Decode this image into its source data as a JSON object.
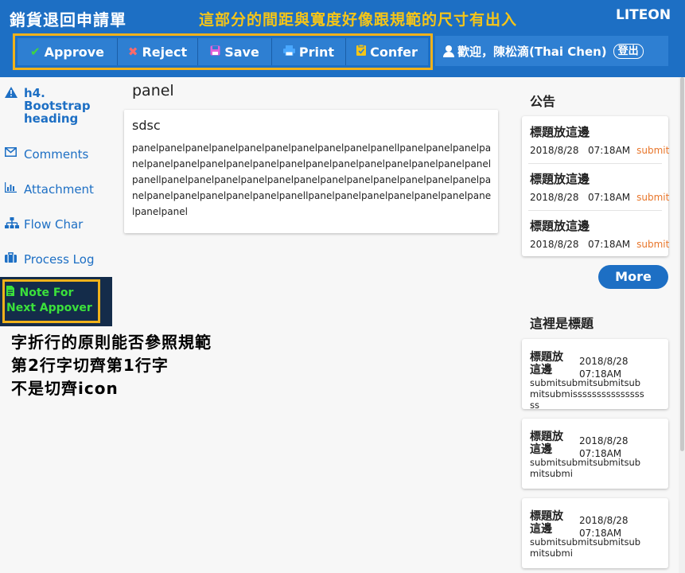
{
  "header": {
    "title": "銷貨退回申請單",
    "annotation": "這部分的間距與寬度好像跟規範的尺寸有出入",
    "logo": "LITEON"
  },
  "toolbar": {
    "approve": "Approve",
    "reject": "Reject",
    "save": "Save",
    "print": "Print",
    "confer": "Confer"
  },
  "user": {
    "greeting": "歡迎，陳松滴(Thai Chen)",
    "logout": "登出"
  },
  "sidebar": {
    "items": [
      {
        "label": "h4. Bootstrap heading",
        "icon": "warning-icon"
      },
      {
        "label": "Comments",
        "icon": "envelope-icon"
      },
      {
        "label": "Attachment",
        "icon": "bar-chart-icon"
      },
      {
        "label": "Flow Char",
        "icon": "sitemap-icon"
      },
      {
        "label": "Process Log",
        "icon": "briefcase-icon"
      }
    ],
    "note": {
      "line1": "Note For",
      "line2": "Next Appover",
      "icon": "document-icon"
    }
  },
  "annotation_left": "字折行的原則能否參照規範\n第2行字切齊第1行字\n不是切齊icon",
  "panel": {
    "title": "panel",
    "card_title": "sdsc",
    "body": "panelpanelpanelpanelpanelpanelpanelpanelpanelpanellpanelpanelpanelpanelpanelpanelpanelpanelpanelpanelpanelpanelpanelpanelpanelpanelpanelpanellpanelpanelpanelpanelpanelpanelpanelpanelpanelpanelpanelpanelpanelpanelpanelpanelpanelpanelpanellpanelpanelpanelpanelpanelpanelpanelpanelpanel"
  },
  "announcements": {
    "title": "公告",
    "items": [
      {
        "title": "標題放這邊",
        "date": "2018/8/28",
        "time": "07:18AM",
        "action": "submit"
      },
      {
        "title": "標題放這邊",
        "date": "2018/8/28",
        "time": "07:18AM",
        "action": "submit"
      },
      {
        "title": "標題放這邊",
        "date": "2018/8/28",
        "time": "07:18AM",
        "action": "submit"
      }
    ],
    "more": "More"
  },
  "news": {
    "title": "這裡是標題",
    "items": [
      {
        "title": "標題放這邊",
        "date": "2018/8/28",
        "time": "07:18AM",
        "body": "submitsubmitsubmitsubmitsubmisssssssssssssssss"
      },
      {
        "title": "標題放這邊",
        "date": "2018/8/28",
        "time": "07:18AM",
        "body": "submitsubmitsubmitsubmitsubmi"
      },
      {
        "title": "標題放這邊",
        "date": "2018/8/28",
        "time": "07:18AM",
        "body": "submitsubmitsubmitsubmitsubmi"
      }
    ]
  },
  "colors": {
    "primary": "#1d6fc4",
    "highlight": "#f0b21b",
    "note_text": "#3be13b",
    "submit_link": "#e8762b"
  }
}
